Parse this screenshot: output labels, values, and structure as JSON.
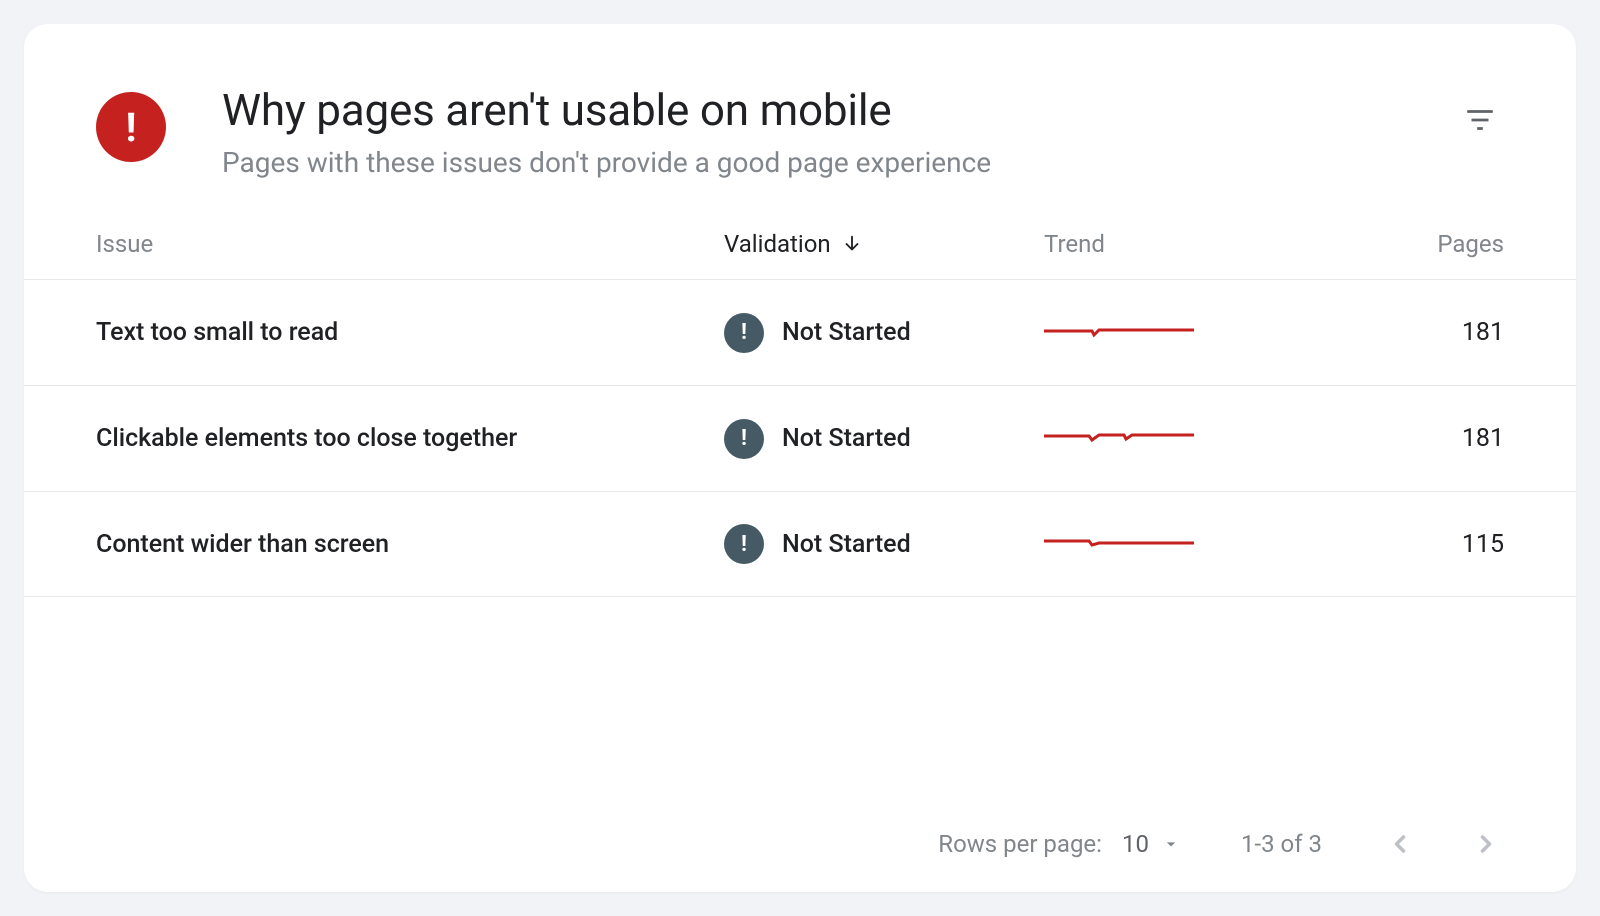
{
  "header": {
    "title": "Why pages aren't usable on mobile",
    "subtitle": "Pages with these issues don't provide a good page experience"
  },
  "columns": {
    "issue": "Issue",
    "validation": "Validation",
    "trend": "Trend",
    "pages": "Pages"
  },
  "rows": [
    {
      "issue": "Text too small to read",
      "validation": "Not Started",
      "pages": "181"
    },
    {
      "issue": "Clickable elements too close together",
      "validation": "Not Started",
      "pages": "181"
    },
    {
      "issue": "Content wider than screen",
      "validation": "Not Started",
      "pages": "115"
    }
  ],
  "footer": {
    "rows_per_page_label": "Rows per page:",
    "rows_per_page_value": "10",
    "range": "1-3 of 3"
  }
}
